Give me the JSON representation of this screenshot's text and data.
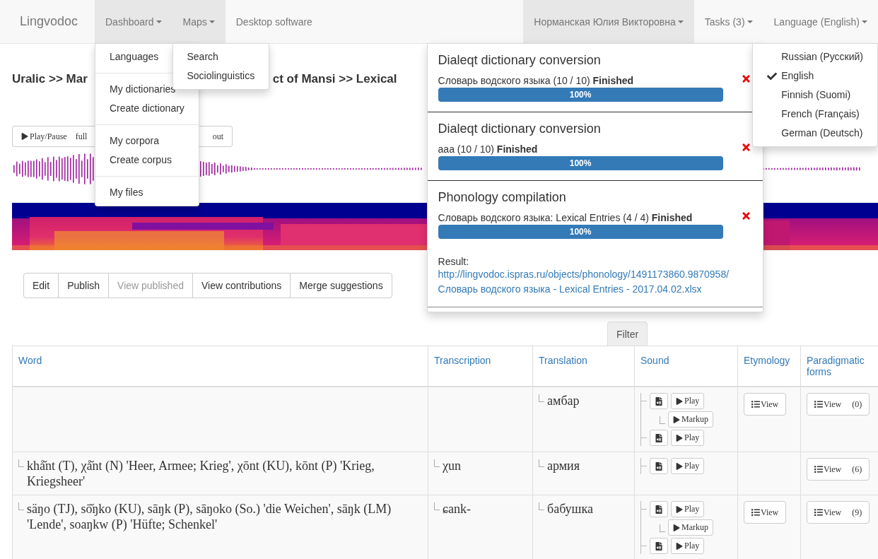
{
  "navbar": {
    "brand": "Lingvodoc",
    "left": [
      {
        "label": "Dashboard",
        "caret": true,
        "active": true,
        "menu": {
          "kind": "groups",
          "groups": [
            [
              "Languages"
            ],
            [
              "My dictionaries",
              "Create dictionary"
            ],
            [
              "My corpora",
              "Create corpus"
            ],
            [
              "My files"
            ]
          ]
        }
      },
      {
        "label": "Maps",
        "caret": true,
        "active": true,
        "menu": {
          "kind": "groups",
          "groups": [
            [
              "Search",
              "Sociolinguistics"
            ]
          ]
        }
      },
      {
        "label": "Desktop software",
        "caret": false,
        "active": false
      }
    ],
    "right": [
      {
        "label": "Норманская Юлия Викторовна",
        "caret": true,
        "active": true
      },
      {
        "label": "Tasks (3)",
        "caret": true,
        "active": false,
        "menu": {
          "kind": "tasks",
          "tasks": [
            {
              "title": "Dialeqt dictionary conversion",
              "description": "Словарь водского языка (10 / 10)",
              "status": "Finished",
              "level": 1,
              "progress": "100%"
            },
            {
              "title": "Dialeqt dictionary conversion",
              "description": "aaa (10 / 10)",
              "status": "Finished",
              "level": 1,
              "progress": "100%"
            },
            {
              "title": "Phonology compilation",
              "description": "Словарь водского языка: Lexical Entries (4 / 4)",
              "status": "Finished",
              "level": 1,
              "progress": "100%",
              "result_label": "Result:",
              "result_link": [
                "http://lingvodoc.ispras.ru/objects/phonology/1491173860.9870958/",
                "Словарь водского языка - Lexical Entries - 2017.04.02.xlsx"
              ]
            }
          ]
        }
      },
      {
        "label": "Language (English)",
        "caret": true,
        "active": false,
        "menu": {
          "kind": "options",
          "options": [
            {
              "label": "Russian (Русский)",
              "selected": false
            },
            {
              "label": "English",
              "selected": true
            },
            {
              "label": "Finnish (Suomi)",
              "selected": false
            },
            {
              "label": "French (Français)",
              "selected": false
            },
            {
              "label": "German (Deutsch)",
              "selected": false
            }
          ]
        }
      }
    ]
  },
  "breadcrumb": [
    "Uralic >> Mar",
    "ct of Mansi >> Lexical"
  ],
  "player": {
    "play": "Play/Pause",
    "full": "full",
    "out": "out"
  },
  "actions": [
    {
      "label": "Edit",
      "disabled": false
    },
    {
      "label": "Publish",
      "disabled": false
    },
    {
      "label": "View published",
      "disabled": true
    },
    {
      "label": "View contributions",
      "disabled": false
    },
    {
      "label": "Merge suggestions",
      "disabled": false
    }
  ],
  "filter": "Filter",
  "table": {
    "columns": [
      "Word",
      "Transcription",
      "Translation",
      "Sound",
      "Etymology",
      "Paradigmatic forms"
    ],
    "rows": [
      {
        "translation": "амбар",
        "sound": [
          {
            "label": "Play",
            "children": [
              {
                "label": "Markup"
              }
            ]
          },
          {
            "label": "Play"
          }
        ],
        "etymology": "View",
        "paradigm": {
          "label": "View",
          "count": "(0)"
        }
      },
      {
        "word": "khå̆nt (T), χå̆nt (N) 'Heer, Armee; Krieg', χōnt (KU), kōnt (P) 'Krieg, Kriegsheer'",
        "transcription": "χun",
        "translation": "армия",
        "sound": [
          {
            "label": "Play"
          }
        ],
        "paradigm": {
          "label": "View",
          "count": "(6)"
        }
      },
      {
        "word": "säŋo (TJ), sō̆ŋko (KU), sāŋk (P), sāŋoko (So.) 'die Weichen', sāŋk (LM) 'Lende', soaŋkw (P) 'Hüfte; Schenkel'",
        "transcription": "ɕank-",
        "translation": "бабушка",
        "sound": [
          {
            "label": "Play",
            "children": [
              {
                "label": "Markup"
              }
            ]
          },
          {
            "label": "Play"
          }
        ],
        "etymology": "View",
        "paradigm": {
          "label": "View",
          "count": "(9)"
        }
      }
    ]
  }
}
